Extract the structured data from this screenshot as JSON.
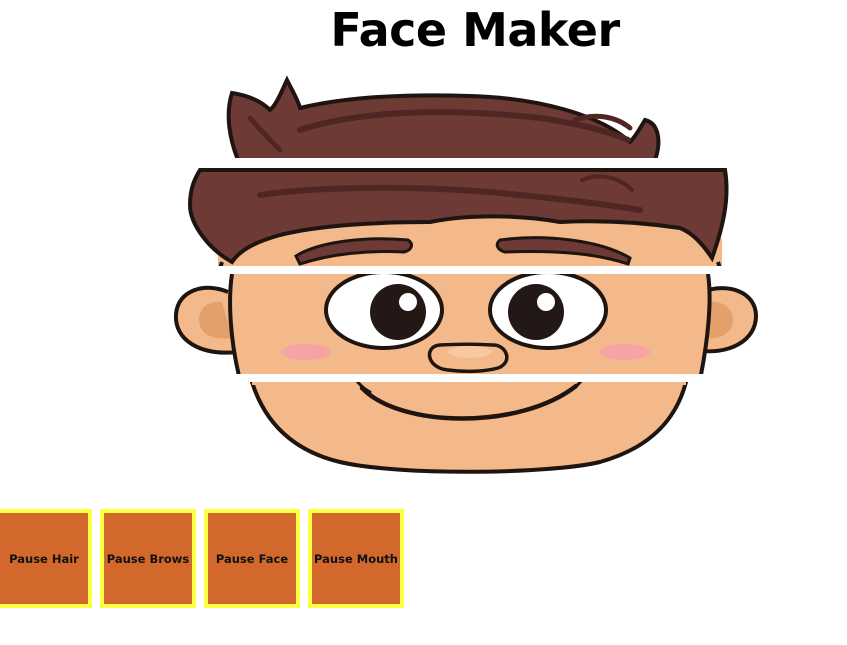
{
  "page": {
    "title": "Face Maker"
  },
  "face": {
    "layers": [
      {
        "id": "hair",
        "icon": "hair-layer"
      },
      {
        "id": "brows",
        "icon": "brows-layer"
      },
      {
        "id": "face",
        "icon": "eyes-nose-layer"
      },
      {
        "id": "mouth",
        "icon": "mouth-layer"
      }
    ],
    "colors": {
      "hair": "#6e3a36",
      "hair_dark": "#4f2623",
      "skin": "#f4b98a",
      "skin_shadow": "#e3a06b",
      "cheek": "#f6a3a6",
      "outline": "#1e1410"
    }
  },
  "controls": {
    "buttons": [
      {
        "label": "Pause Hair"
      },
      {
        "label": "Pause Brows"
      },
      {
        "label": "Pause Face"
      },
      {
        "label": "Pause Mouth"
      }
    ],
    "colors": {
      "fill": "#d2682b",
      "border": "#ffff44"
    }
  }
}
